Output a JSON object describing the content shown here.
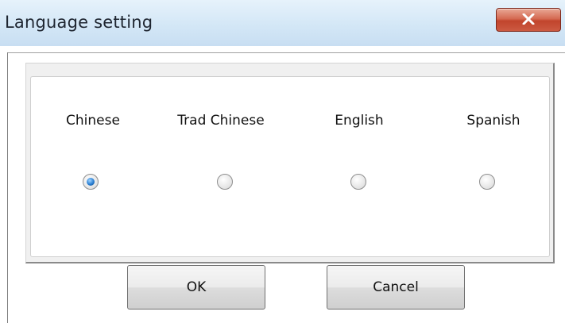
{
  "window": {
    "title": "Language setting",
    "close_icon": "close-icon"
  },
  "languages": [
    {
      "label": "Chinese",
      "selected": true
    },
    {
      "label": "Trad Chinese",
      "selected": false
    },
    {
      "label": "English",
      "selected": false
    },
    {
      "label": "Spanish",
      "selected": false
    }
  ],
  "buttons": {
    "ok_label": "OK",
    "cancel_label": "Cancel"
  },
  "colors": {
    "titlebar": "#d2e6f6",
    "close_button": "#c1442c",
    "radio_selected": "#2a7fd2",
    "group_background": "#f0f0f0"
  }
}
